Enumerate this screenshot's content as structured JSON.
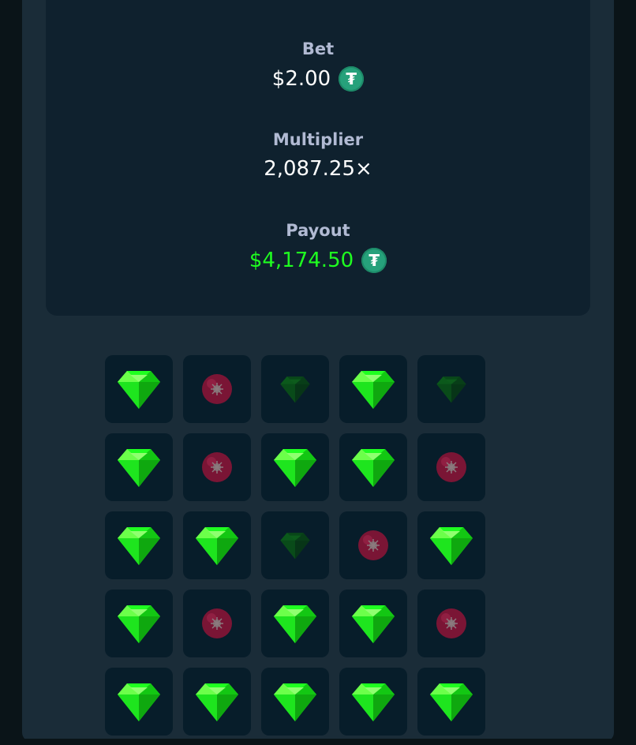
{
  "stats": {
    "bet_label": "Bet",
    "bet_value": "$2.00",
    "multiplier_label": "Multiplier",
    "multiplier_value": "2,087.25×",
    "payout_label": "Payout",
    "payout_value": "$4,174.50"
  },
  "currency_icon": "tether-icon",
  "colors": {
    "gem": "#1fff20",
    "gem_dim": "#0c6b0c",
    "mine": "#7a1535",
    "tile": "#071d2a",
    "payout": "#1fff20"
  },
  "grid": [
    [
      "gem",
      "mine",
      "gem-dim",
      "gem",
      "gem-dim"
    ],
    [
      "gem",
      "mine",
      "gem",
      "gem",
      "mine"
    ],
    [
      "gem",
      "gem",
      "gem-dim",
      "mine",
      "gem"
    ],
    [
      "gem",
      "mine",
      "gem",
      "gem",
      "mine"
    ],
    [
      "gem",
      "gem",
      "gem",
      "gem",
      "gem"
    ]
  ]
}
